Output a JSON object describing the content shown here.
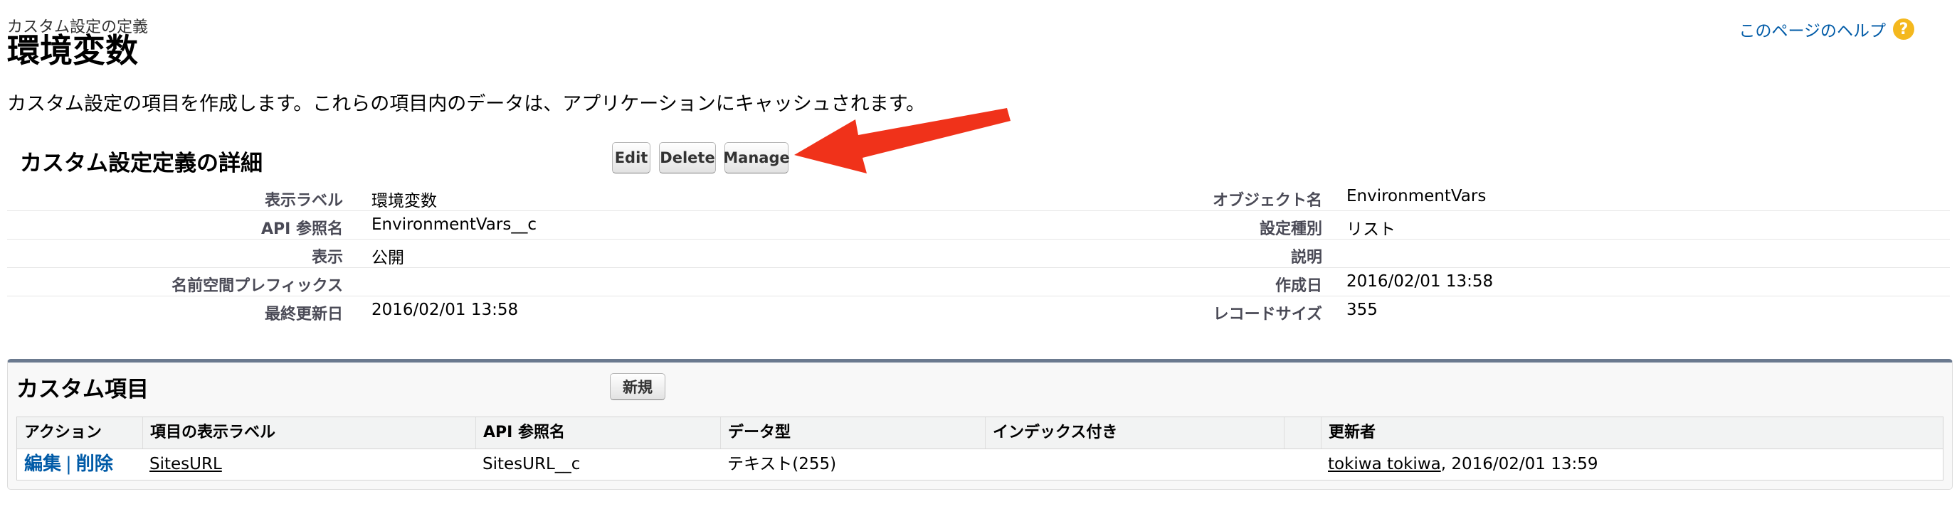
{
  "header": {
    "breadcrumb": "カスタム設定の定義",
    "title": "環境変数",
    "help_link": "このページのヘルプ",
    "help_icon": "help-icon"
  },
  "description": "カスタム設定の項目を作成します。これらの項目内のデータは、アプリケーションにキャッシュされます。",
  "detail": {
    "title": "カスタム設定定義の詳細",
    "buttons": {
      "edit": "Edit",
      "delete": "Delete",
      "manage": "Manage"
    },
    "left": [
      {
        "label": "表示ラベル",
        "value": "環境変数"
      },
      {
        "label": "API 参照名",
        "value": "EnvironmentVars__c"
      },
      {
        "label": "表示",
        "value": "公開"
      },
      {
        "label": "名前空間プレフィックス",
        "value": ""
      },
      {
        "label": "最終更新日",
        "value": "2016/02/01 13:58"
      }
    ],
    "right": [
      {
        "label": "オブジェクト名",
        "value": "EnvironmentVars"
      },
      {
        "label": "設定種別",
        "value": "リスト"
      },
      {
        "label": "説明",
        "value": ""
      },
      {
        "label": "作成日",
        "value": "2016/02/01 13:58"
      },
      {
        "label": "レコードサイズ",
        "value": "355"
      }
    ]
  },
  "annotation": {
    "arrow_color": "#f0321a"
  },
  "custom_fields": {
    "title": "カスタム項目",
    "new_button": "新規",
    "columns": [
      "アクション",
      "項目の表示ラベル",
      "API 参照名",
      "データ型",
      "インデックス付き",
      "",
      "更新者"
    ],
    "rows": [
      {
        "action_edit": "編集",
        "action_sep": "|",
        "action_delete": "削除",
        "label": "SitesURL",
        "api_name": "SitesURL__c",
        "data_type": "テキスト(255)",
        "indexed": "",
        "modified_by_user": "tokiwa tokiwa",
        "modified_by_date": ", 2016/02/01 13:59"
      }
    ]
  }
}
